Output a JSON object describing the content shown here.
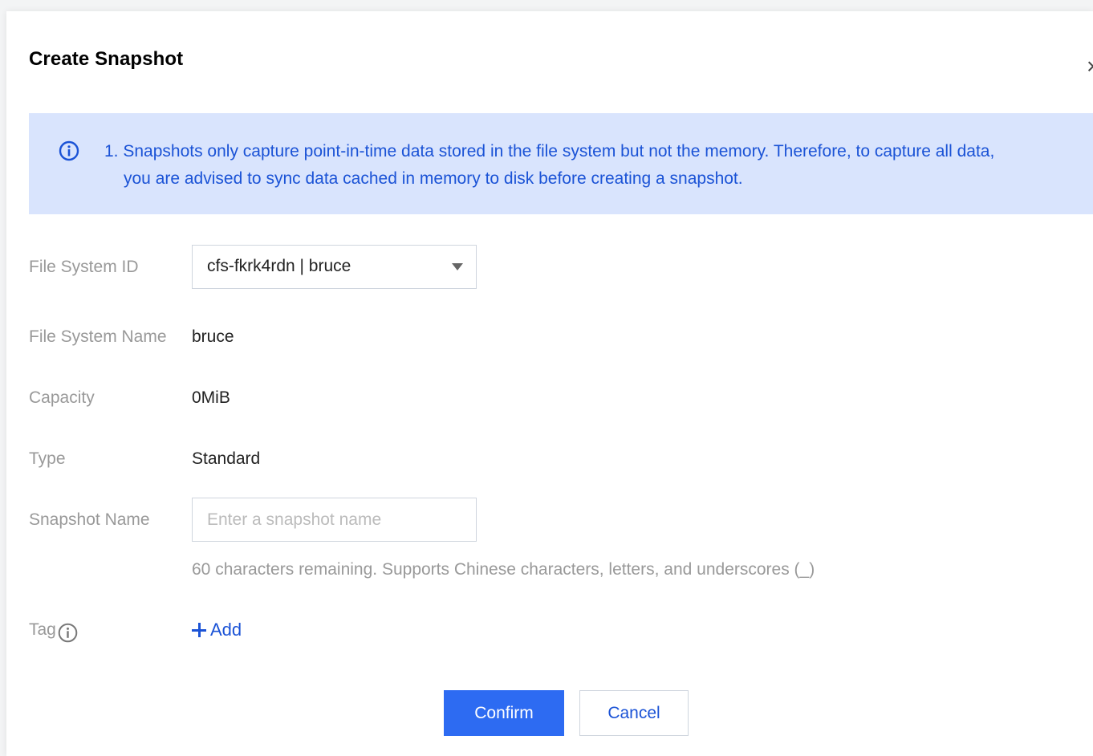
{
  "dialog": {
    "title": "Create Snapshot",
    "close_icon": "close-icon"
  },
  "notice": {
    "icon": "info-circle-icon",
    "line1": "1. Snapshots only capture point-in-time data stored in the file system but not the memory. Therefore, to capture all data,",
    "line2": "you are advised to sync data cached in memory to disk before creating a snapshot."
  },
  "form": {
    "file_system_id": {
      "label": "File System ID",
      "value": "cfs-fkrk4rdn | bruce"
    },
    "file_system_name": {
      "label": "File System Name",
      "value": "bruce"
    },
    "capacity": {
      "label": "Capacity",
      "value": "0MiB"
    },
    "type": {
      "label": "Type",
      "value": "Standard"
    },
    "snapshot_name": {
      "label": "Snapshot Name",
      "placeholder": "Enter a snapshot name",
      "value": "",
      "hint": "60 characters remaining. Supports Chinese characters, letters, and underscores (_)"
    },
    "tag": {
      "label": "Tag",
      "info_icon": "info-circle-icon",
      "add_label": "Add"
    }
  },
  "buttons": {
    "confirm": "Confirm",
    "cancel": "Cancel"
  },
  "colors": {
    "accent": "#2d6bf2",
    "link": "#1b53d6",
    "notice_bg": "#d9e4fd",
    "label": "#999999"
  }
}
